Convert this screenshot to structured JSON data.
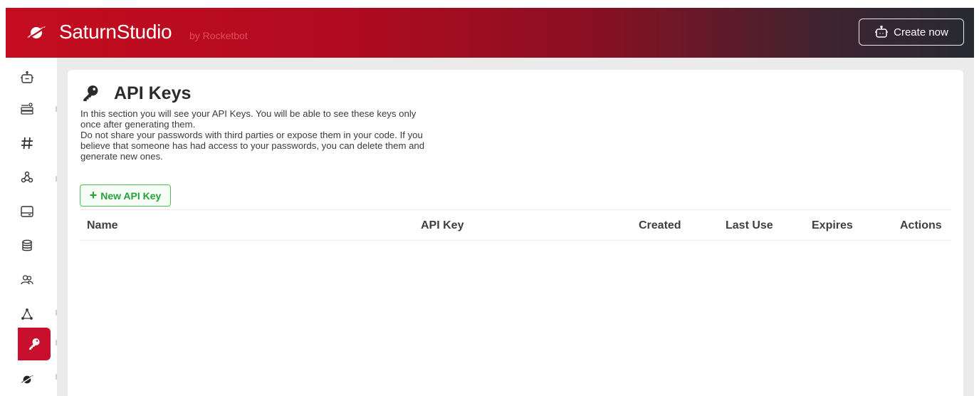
{
  "header": {
    "brand_name": "SaturnStudio",
    "brand_by": "by Rocketbot",
    "create_label": "Create now",
    "gradient_colors": [
      "#c40c1f",
      "#272a33"
    ]
  },
  "sidebar": {
    "items": [
      {
        "icon": "robot-icon",
        "active": false
      },
      {
        "icon": "server-config-icon",
        "active": false
      },
      {
        "icon": "hashtag-icon",
        "active": false
      },
      {
        "icon": "webhook-icon",
        "active": false
      },
      {
        "icon": "storage-drive-icon",
        "active": false
      },
      {
        "icon": "database-icon",
        "active": false
      },
      {
        "icon": "users-group-icon",
        "active": false
      },
      {
        "icon": "network-triangle-icon",
        "active": false
      },
      {
        "icon": "key-icon",
        "active": true
      },
      {
        "icon": "saturn-logo-icon",
        "active": false
      }
    ],
    "active_color": "#c8102e"
  },
  "page": {
    "title": "API Keys",
    "desc_line1": "In this section you will see your API Keys. You will be able to see these keys only",
    "desc_line2": "once after generating them.",
    "desc_line3": "Do not share your passwords with third parties or expose them in your code. If you",
    "desc_line4": "believe that someone has had access to your passwords, you can delete them and",
    "desc_line5": "generate new ones.",
    "new_button": "New API Key",
    "new_button_plus": "+"
  },
  "table": {
    "headers": [
      "Name",
      "API Key",
      "Created",
      "Last Use",
      "Expires",
      "Actions"
    ],
    "rows": []
  }
}
